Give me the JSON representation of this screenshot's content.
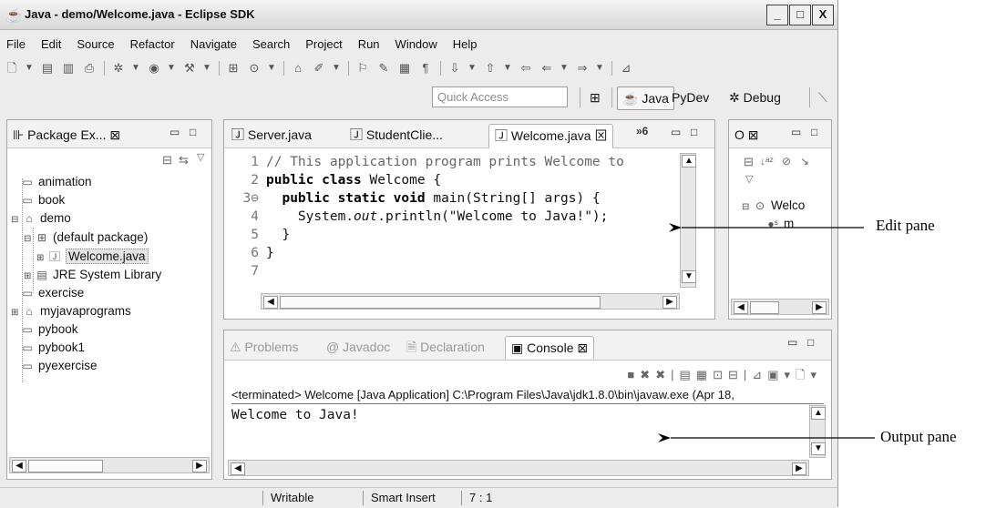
{
  "window": {
    "title": "Java - demo/Welcome.java - Eclipse SDK",
    "controls": [
      "_",
      "□",
      "X"
    ]
  },
  "menu": [
    {
      "label": "File"
    },
    {
      "label": "Edit"
    },
    {
      "label": "Source"
    },
    {
      "label": "Refactor"
    },
    {
      "label": "Navigate"
    },
    {
      "label": "Search"
    },
    {
      "label": "Project"
    },
    {
      "label": "Run"
    },
    {
      "label": "Window"
    },
    {
      "label": "Help"
    }
  ],
  "quick_access": {
    "placeholder": "Quick Access"
  },
  "perspectives": {
    "java": "Java",
    "pydev": "PyDev",
    "debug": "Debug"
  },
  "package_explorer": {
    "tab": "Package Ex...",
    "items": [
      {
        "label": "animation"
      },
      {
        "label": "book"
      },
      {
        "label": "demo"
      },
      {
        "label": "(default package)"
      },
      {
        "label": "Welcome.java"
      },
      {
        "label": "JRE System Library"
      },
      {
        "label": "exercise"
      },
      {
        "label": "myjavaprograms"
      },
      {
        "label": "pybook"
      },
      {
        "label": "pybook1"
      },
      {
        "label": "pyexercise"
      }
    ]
  },
  "editor": {
    "tabs": [
      {
        "label": "Server.java"
      },
      {
        "label": "StudentClie..."
      },
      {
        "label": "Welcome.java"
      }
    ],
    "overflow": "»6",
    "lines": [
      {
        "num": "1"
      },
      {
        "num": "2"
      },
      {
        "num": "3⊖"
      },
      {
        "num": "4"
      },
      {
        "num": "5"
      },
      {
        "num": "6"
      },
      {
        "num": "7"
      }
    ],
    "code": {
      "l1": "// This application program prints Welcome to",
      "l2_kw": "public class",
      "l2_rest": " Welcome {",
      "l3_kw": "public static void",
      "l3_rest": " main(String[] args) {",
      "l4_a": "System.",
      "l4_it": "out",
      "l4_b": ".println(\"Welcome to Java!\");",
      "l5": "  }",
      "l6": "}"
    }
  },
  "outline": {
    "tab": "O",
    "items": [
      {
        "label": "Welco"
      },
      {
        "label": "m"
      }
    ]
  },
  "console": {
    "tabs": [
      {
        "label": "Problems"
      },
      {
        "label": "Javadoc"
      },
      {
        "label": "Declaration"
      },
      {
        "label": "Console"
      }
    ],
    "terminated": "<terminated> Welcome [Java Application] C:\\Program Files\\Java\\jdk1.8.0\\bin\\javaw.exe (Apr 18,",
    "output": "Welcome to Java!"
  },
  "status": {
    "writable": "Writable",
    "insert": "Smart Insert",
    "position": "7 : 1"
  },
  "callouts": {
    "edit": "Edit pane",
    "output": "Output pane"
  }
}
